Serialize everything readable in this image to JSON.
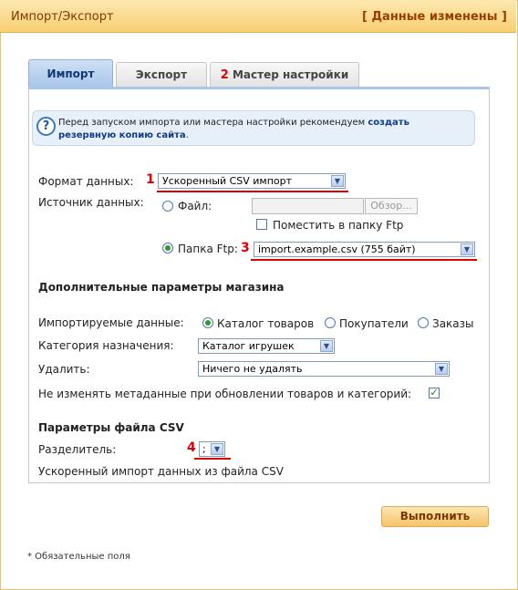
{
  "header": {
    "title": "Импорт/Экспорт",
    "status": "[ Данные изменены ]"
  },
  "tabs": [
    {
      "label": "Импорт",
      "active": true
    },
    {
      "label": "Экспорт",
      "active": false
    },
    {
      "label": "Мастер настройки",
      "active": false
    }
  ],
  "info": {
    "text_before": "Перед запуском импорта или мастера настройки рекомендуем ",
    "link": "создать резервную копию сайта",
    "text_after": "."
  },
  "form": {
    "format_label": "Формат данных:",
    "format_value": "Ускоренный CSV импорт",
    "source_label": "Источник данных:",
    "file_label": "Файл:",
    "browse_label": "Обзор...",
    "put_ftp_label": "Поместить в папку Ftp",
    "ftp_label": "Папка Ftp:",
    "ftp_value": "import.example.csv (755 байт)",
    "source_selected": "ftp"
  },
  "shop": {
    "section_title": "Дополнительные параметры магазина",
    "imported_label": "Импортируемые данные:",
    "options": [
      "Каталог товаров",
      "Покупатели",
      "Заказы"
    ],
    "selected_option": "Каталог товаров",
    "category_label": "Категория назначения:",
    "category_value": "Каталог игрушек",
    "delete_label": "Удалить:",
    "delete_value": "Ничего не удалять",
    "keep_meta_label": "Не изменять метаданные при обновлении товаров и категорий:",
    "keep_meta_checked": true
  },
  "csv": {
    "section_title": "Параметры файла CSV",
    "separator_label": "Разделитель:",
    "separator_value": ";",
    "description": "Ускоренный импорт данных из файла CSV"
  },
  "markers": [
    "1",
    "2",
    "3",
    "4"
  ],
  "run_button": "Выполнить",
  "footnote": "* Обязательные поля",
  "colors": {
    "accent_red": "#e00000",
    "header_text": "#7d3800",
    "tab_active": "#a9c6ea"
  }
}
